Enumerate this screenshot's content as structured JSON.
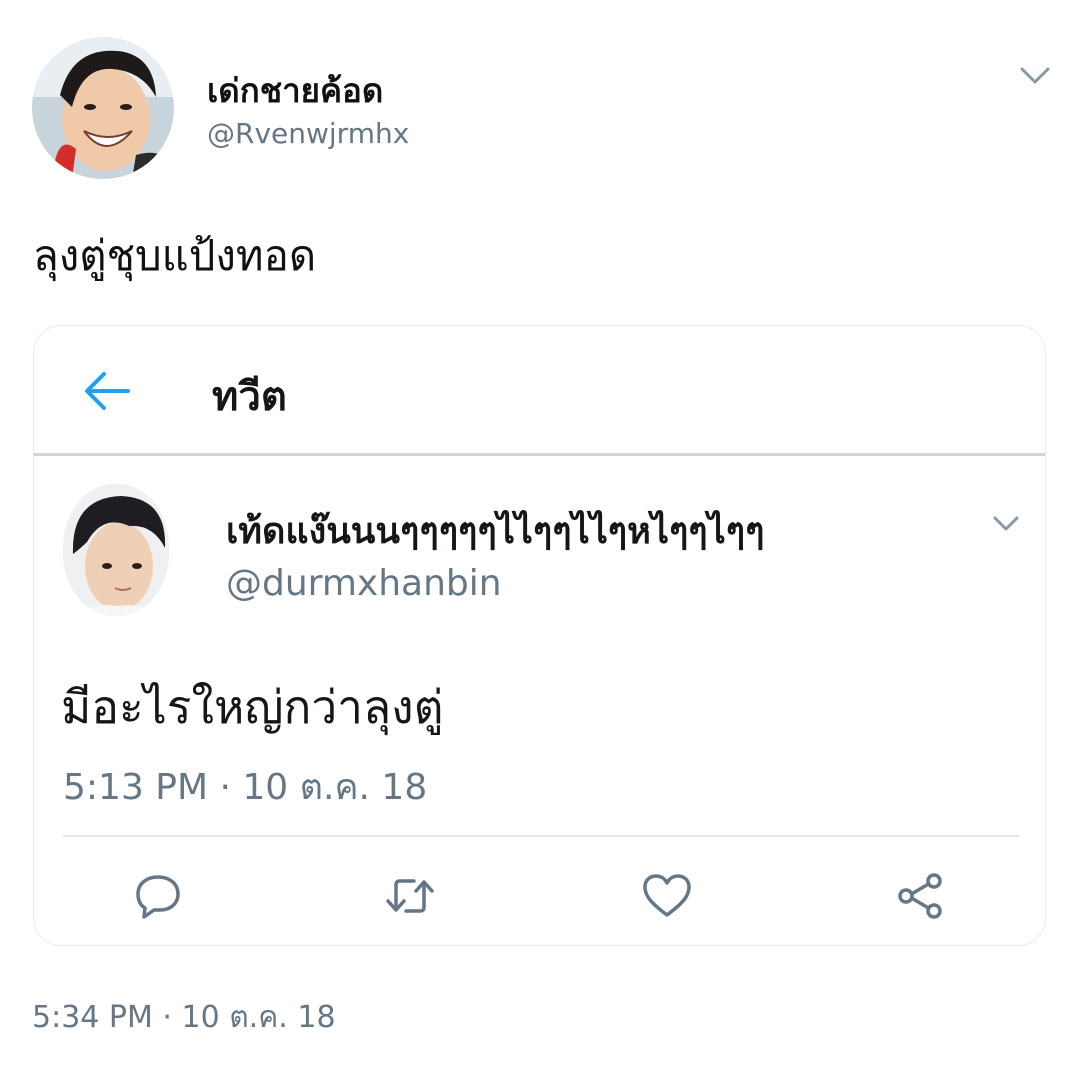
{
  "tweet": {
    "author_name": "เด่กชายค้อด",
    "author_handle": "@Rvenwjrmhx",
    "text": "ลุงตู่ชุบแป้งทอด",
    "timestamp": "5:34 PM · 10 ต.ค. 18",
    "menu_icon": "chevron-down-icon"
  },
  "quoted_screenshot": {
    "header": {
      "back_icon": "arrow-left-icon",
      "title": "ทวีต"
    },
    "tweet": {
      "author_name": "เท้ดแง๊นนนๆๆๆๆๆไไๆๆไไๆหไๆๆไๆๆ",
      "author_handle": "@durmxhanbin",
      "text": "มีอะไรใหญ่กว่าลุงตู่",
      "timestamp": "5:13 PM · 10 ต.ค. 18",
      "menu_icon": "chevron-down-icon"
    },
    "actions": [
      "reply-icon",
      "retweet-icon",
      "like-icon",
      "share-icon"
    ]
  },
  "colors": {
    "accent": "#1da1f2",
    "secondary_text": "#657786",
    "icon_gray": "#657786",
    "divider": "#e1e8ed"
  }
}
